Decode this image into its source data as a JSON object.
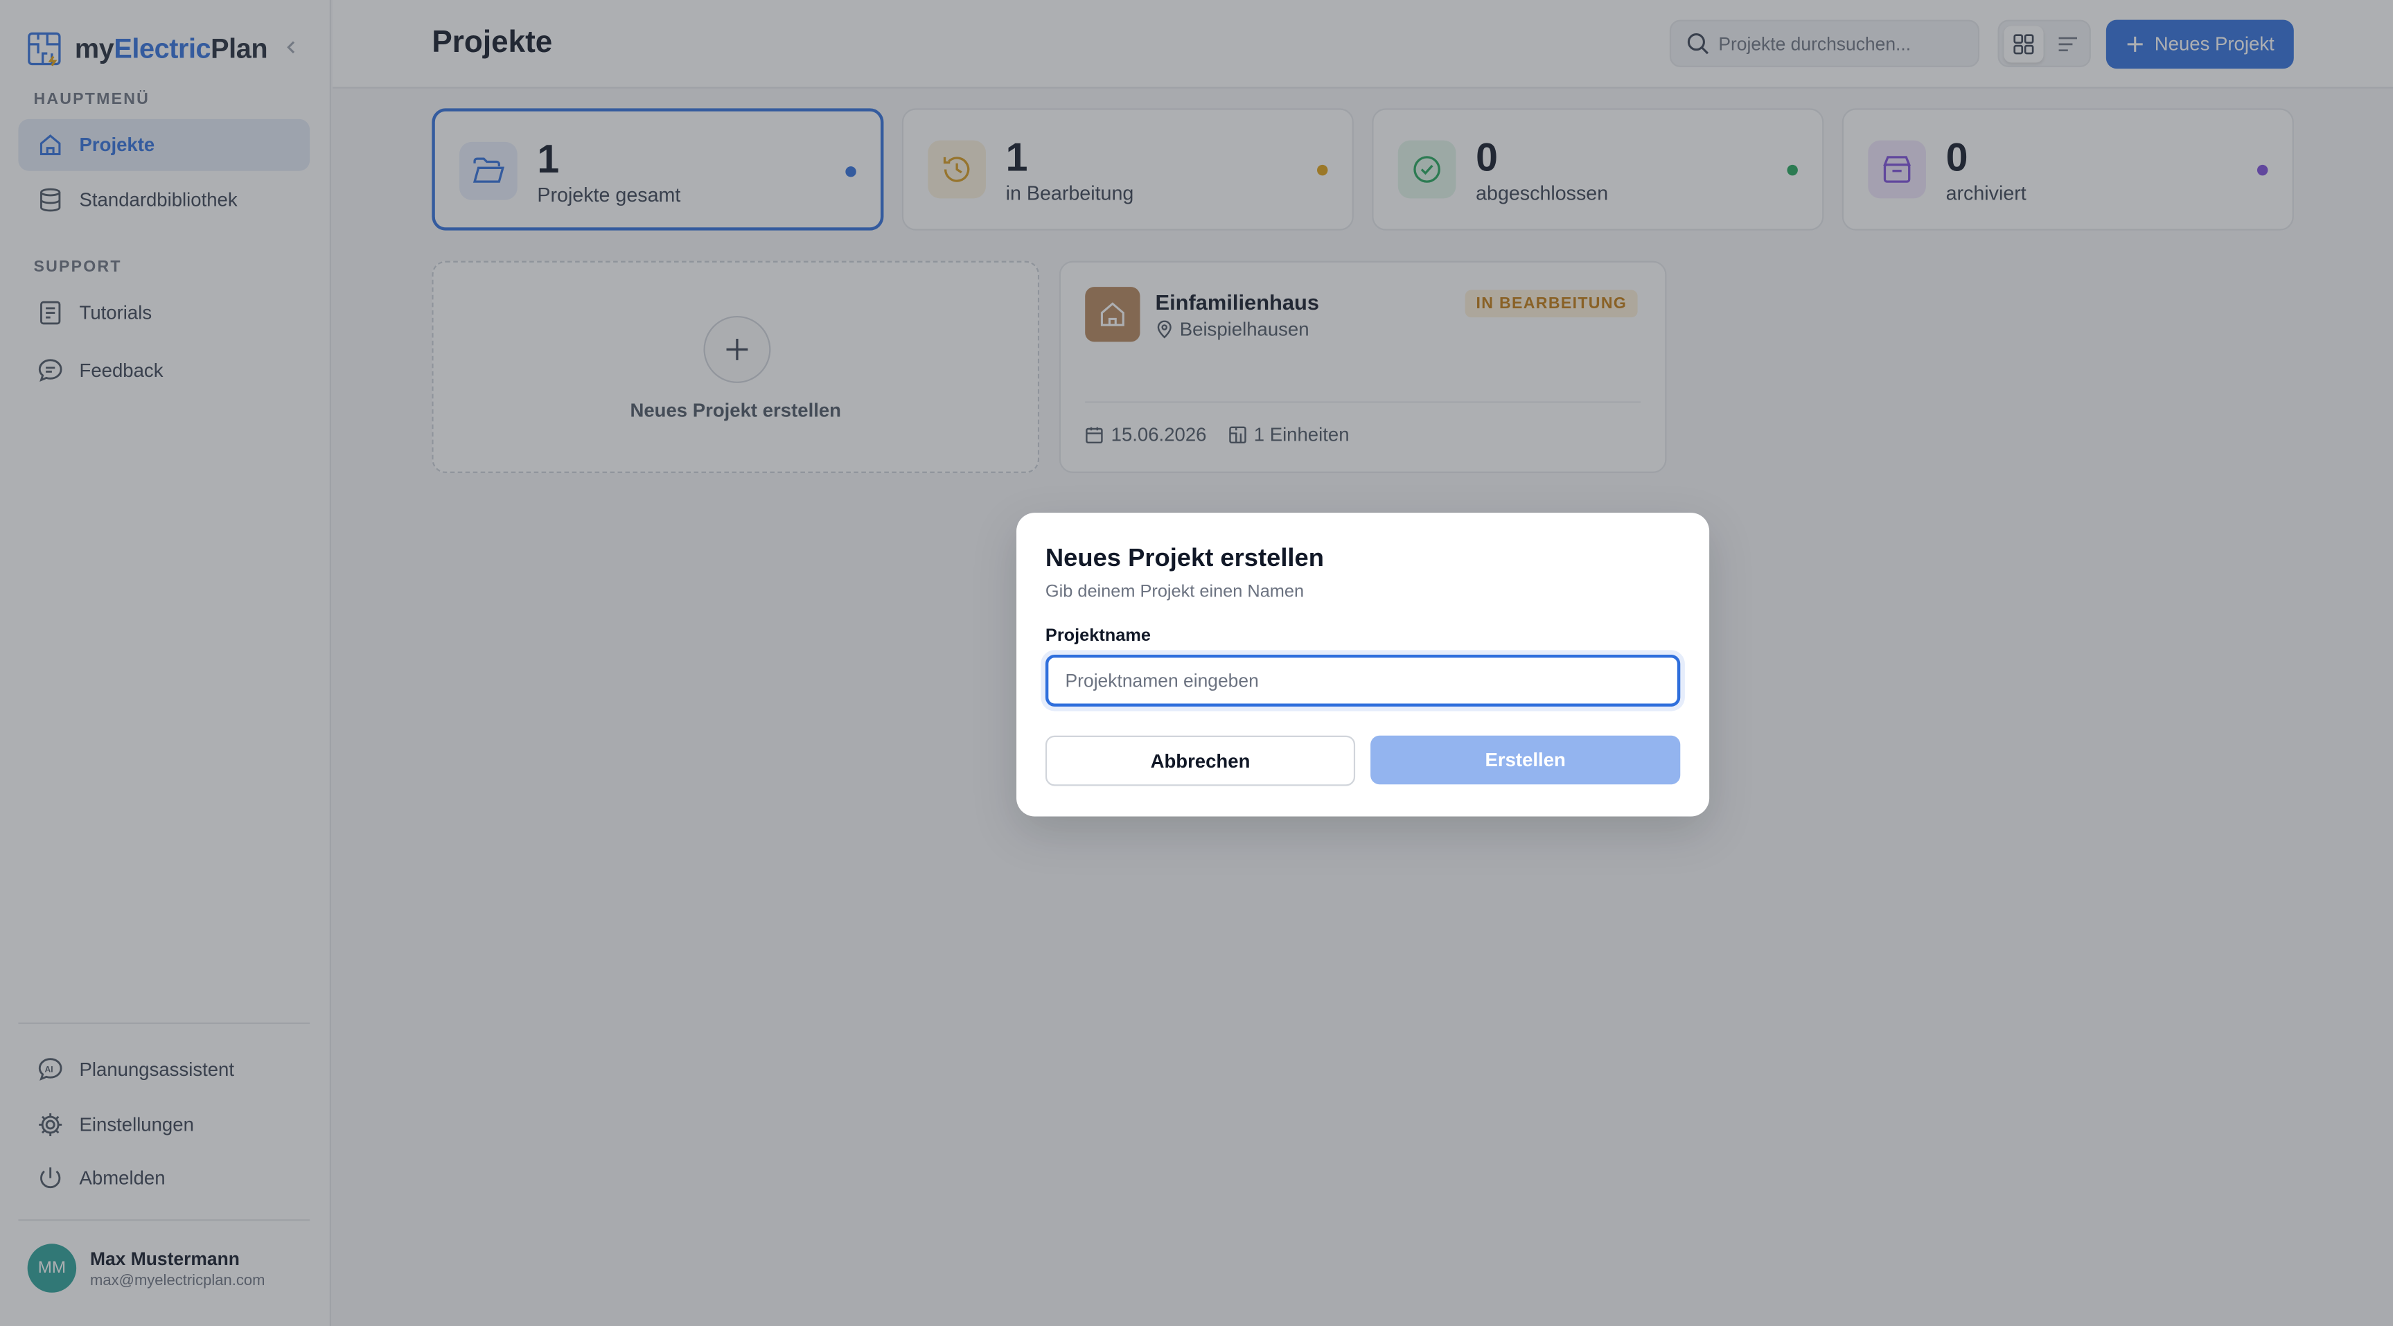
{
  "brand": {
    "prefix": "my",
    "accent": "Electric",
    "suffix": "Plan",
    "accent_color": "#2f6fdc"
  },
  "sidebar": {
    "main_section": "HAUPTMENÜ",
    "main_items": [
      {
        "label": "Projekte",
        "icon": "home-icon",
        "active": true
      },
      {
        "label": "Standardbibliothek",
        "icon": "database-icon"
      }
    ],
    "support_section": "SUPPORT",
    "support_items": [
      {
        "label": "Tutorials",
        "icon": "book-icon"
      },
      {
        "label": "Feedback",
        "icon": "chat-icon"
      }
    ],
    "bottom_items": [
      {
        "label": "Planungsassistent",
        "icon": "ai-icon"
      },
      {
        "label": "Einstellungen",
        "icon": "gear-icon"
      },
      {
        "label": "Abmelden",
        "icon": "power-icon"
      }
    ],
    "user": {
      "initials": "MM",
      "name": "Max Mustermann",
      "email": "max@myelectricplan.com"
    }
  },
  "header": {
    "title": "Projekte",
    "search_placeholder": "Projekte durchsuchen...",
    "new_button": "Neues Projekt"
  },
  "stats": [
    {
      "value": "1",
      "label": "Projekte gesamt",
      "color": "#2f6fdc",
      "icon": "folder-icon"
    },
    {
      "value": "1",
      "label": "in Bearbeitung",
      "color": "#e0a012",
      "icon": "clock-icon"
    },
    {
      "value": "0",
      "label": "abgeschlossen",
      "color": "#22a55b",
      "icon": "check-circle-icon"
    },
    {
      "value": "0",
      "label": "archiviert",
      "color": "#7c4ddb",
      "icon": "archive-icon"
    }
  ],
  "new_project_card": {
    "label": "Neues Projekt erstellen"
  },
  "project": {
    "title": "Einfamilienhaus",
    "location": "Beispielhausen",
    "status": "IN BEARBEITUNG",
    "date": "15.06.2026",
    "units": "1 Einheiten"
  },
  "modal": {
    "title": "Neues Projekt erstellen",
    "subtitle": "Gib deinem Projekt einen Namen",
    "field_label": "Projektname",
    "field_placeholder": "Projektnamen eingeben",
    "field_value": "",
    "cancel": "Abbrechen",
    "create": "Erstellen"
  }
}
